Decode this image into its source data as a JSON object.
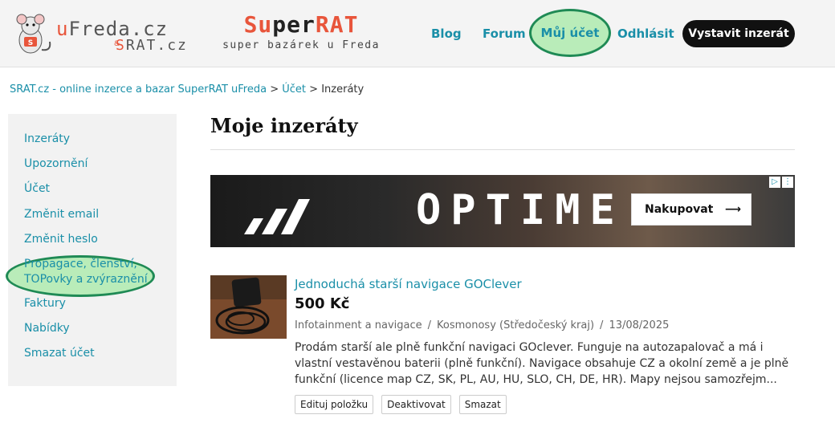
{
  "header": {
    "logo1": {
      "u": "u",
      "freda": "Freda",
      "cz": ".cz",
      "amp": "&",
      "s": "S",
      "rat": "RAT.cz"
    },
    "logo2": {
      "s": "S",
      "u": "u",
      "per": "per",
      "rat": "RAT",
      "tagline": "super bazárek u Freda"
    },
    "nav": {
      "blog": "Blog",
      "forum": "Forum",
      "account": "Můj účet",
      "logout": "Odhlásit",
      "post": "Vystavit inzerát"
    },
    "accent": "#1a8fa8",
    "highlight": "#b9ecb9",
    "highlight_border": "#1f8a55"
  },
  "breadcrumb": {
    "home": "SRAT.cz - online inzerce a bazar SuperRAT uFreda",
    "sep1": ">",
    "account": "Účet",
    "sep2": ">",
    "current": "Inzeráty"
  },
  "sidebar": {
    "items": [
      {
        "label": "Inzeráty"
      },
      {
        "label": "Upozornění"
      },
      {
        "label": "Účet"
      },
      {
        "label": "Změnit email"
      },
      {
        "label": "Změnit heslo"
      },
      {
        "label": "Propagace, členství, TOPovky a zvýraznění",
        "highlighted": true
      },
      {
        "label": "Faktury"
      },
      {
        "label": "Nabídky"
      },
      {
        "label": "Smazat účet"
      }
    ]
  },
  "main": {
    "title": "Moje inzeráty",
    "ad": {
      "text": "OPTIME",
      "button": "Nakupovat",
      "arrow": "⟶",
      "badge1": "▷",
      "badge2": "⋮"
    },
    "listing": {
      "title": "Jednoduchá starší navigace GOClever",
      "price": "500 Kč",
      "category": "Infotainment a navigace",
      "location": "Kosmonosy (Středočeský kraj)",
      "date": "13/08/2025",
      "meta_sep": "/",
      "description": "Prodám starší ale plně funkční navigaci GOclever. Funguje na autozapalovač a má i vlastní vestavěnou baterii (plně funkční). Navigace obsahuje CZ a okolní země a je plně funkční (licence map CZ, SK, PL, AU, HU, SLO, CH, DE, HR). Mapy nejsou samozřejm...",
      "actions": {
        "edit": "Edituj položku",
        "deactivate": "Deaktivovat",
        "delete": "Smazat"
      }
    }
  }
}
